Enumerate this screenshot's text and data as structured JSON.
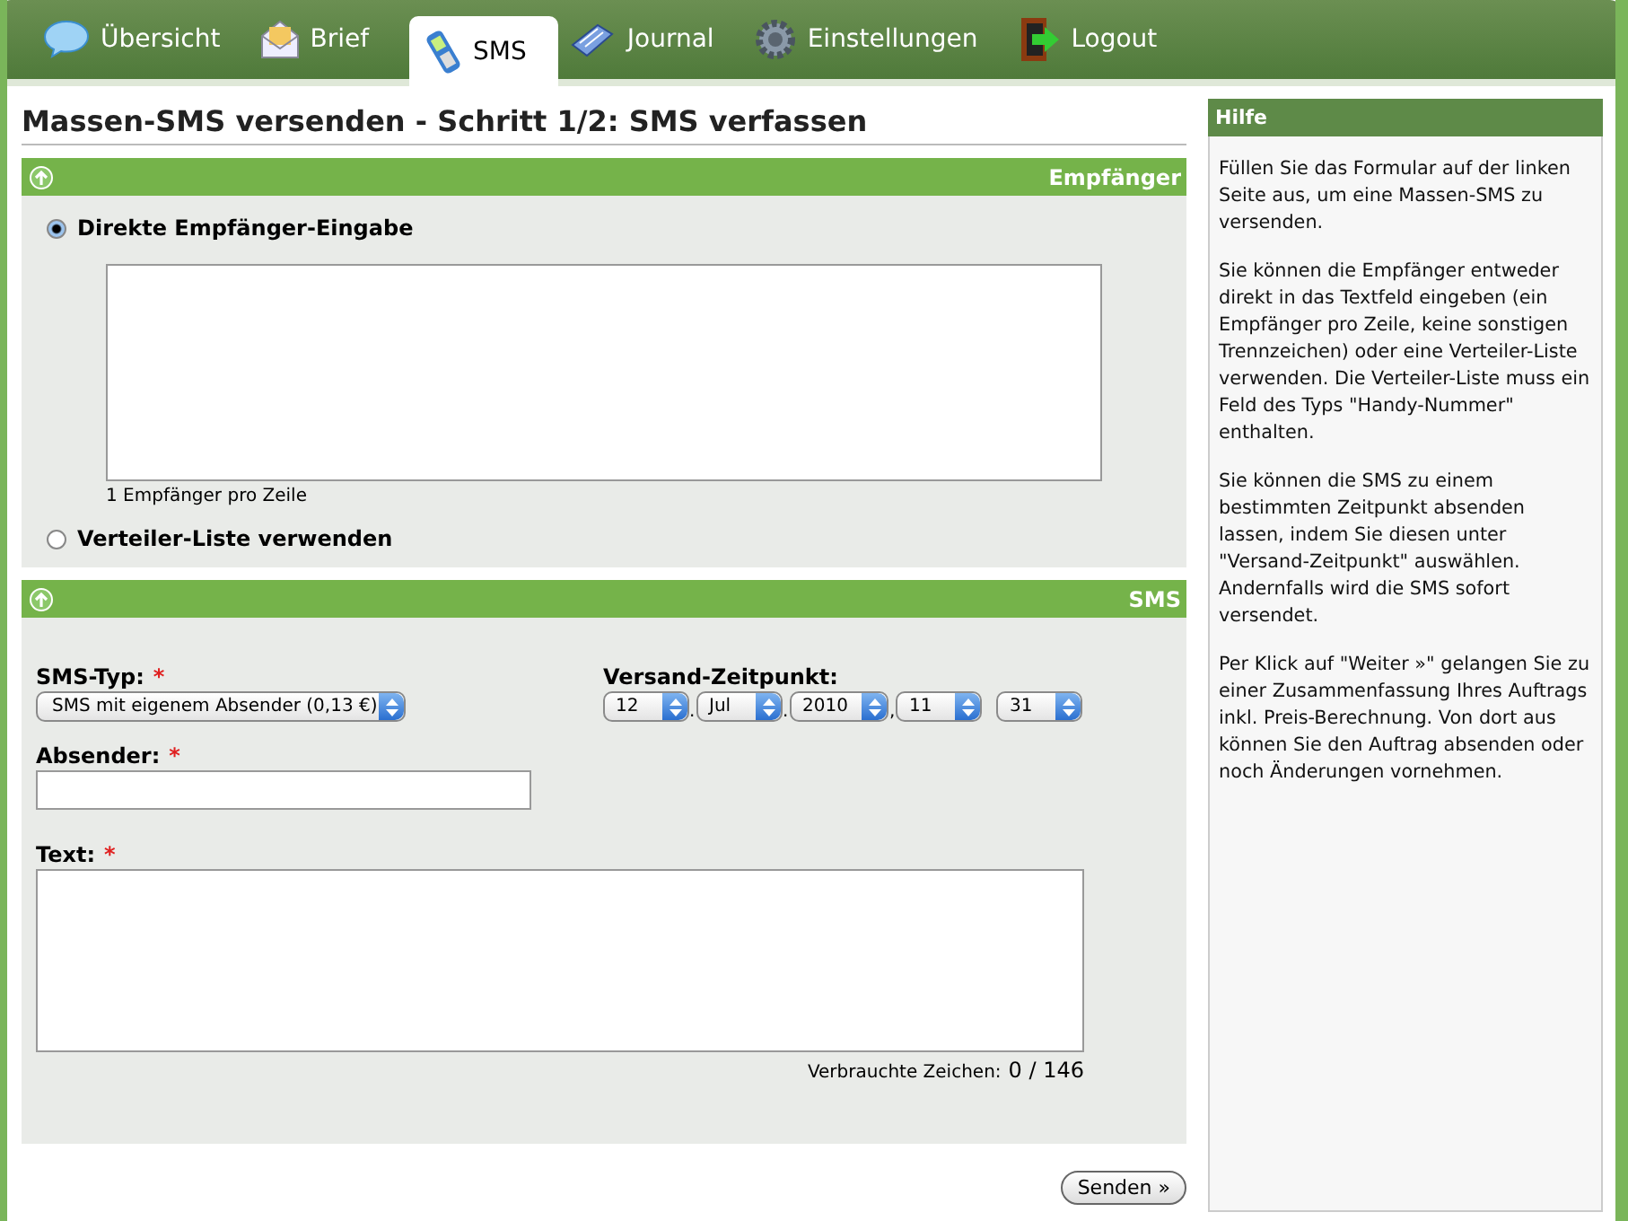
{
  "nav": {
    "tabs": [
      {
        "label": "Übersicht",
        "selected": false
      },
      {
        "label": "Brief",
        "selected": false
      },
      {
        "label": "SMS",
        "selected": true
      },
      {
        "label": "Journal",
        "selected": false
      },
      {
        "label": "Einstellungen",
        "selected": false
      },
      {
        "label": "Logout",
        "selected": false
      }
    ]
  },
  "page_title": "Massen-SMS versenden - Schritt 1/2: SMS verfassen",
  "required_mark": "*",
  "recipients": {
    "title": "Empfänger",
    "options": [
      {
        "label": "Direkte Empfänger-Eingabe",
        "selected": true
      },
      {
        "label": "Verteiler-Liste verwenden",
        "selected": false
      }
    ],
    "hint": "1 Empfänger pro Zeile"
  },
  "sms": {
    "title": "SMS",
    "sms_type": {
      "label": "SMS-Typ:",
      "required": true,
      "value": "SMS mit eigenem Absender (0,13 €)"
    },
    "send_time": {
      "label": "Versand-Zeitpunkt:",
      "selects": [
        {
          "value": "12",
          "separator": "."
        },
        {
          "value": "Jul",
          "separator": "."
        },
        {
          "value": "2010",
          "separator": ","
        },
        {
          "value": "11"
        },
        {
          "value": "31"
        }
      ]
    },
    "sender": {
      "label": "Absender:",
      "required": true
    },
    "text": {
      "label": "Text:",
      "required": true
    },
    "counter_label": "Verbrauchte Zeichen:",
    "counter_value": "0 / 146"
  },
  "submit": "Senden »",
  "help": {
    "title": "Hilfe",
    "paragraphs": [
      "Füllen Sie das Formular auf der linken Seite aus, um eine Massen-SMS zu versenden.",
      "Sie können die Empfänger entweder direkt in das Textfeld eingeben (ein Empfänger pro Zeile, keine sonstigen Trennzeichen) oder eine Verteiler-Liste verwenden. Die Verteiler-Liste muss ein Feld des Typs \"Handy-Nummer\" enthalten.",
      "Sie können die SMS zu einem bestimmten Zeitpunkt absenden lassen, indem Sie diesen unter \"Versand-Zeitpunkt\" auswählen. Andernfalls wird die SMS sofort versendet.",
      "Per Klick auf \"Weiter »\" gelangen Sie zu einer Zusammenfassung Ihres Auftrags inkl. Preis-Berechnung. Von dort aus können Sie den Auftrag absenden oder noch Änderungen vornehmen."
    ]
  }
}
